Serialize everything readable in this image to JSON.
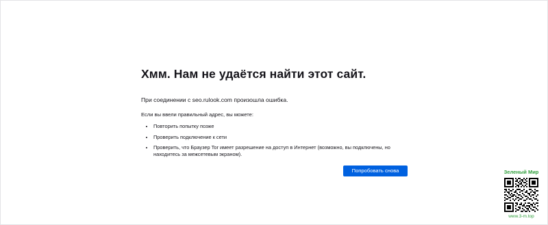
{
  "error": {
    "title": "Хмм. Нам не удаётся найти этот сайт.",
    "description": "При соединении с seo.rulook.com произошла ошибка.",
    "hint": "Если вы ввели правильный адрес, вы можете:",
    "suggestions": [
      "Повторить попытку позже",
      "Проверить подключение к сети",
      "Проверить, что Браузер Tor имеет разрешение на доступ в Интернет (возможно, вы подключены, но находитесь за межсетевым экраном)."
    ],
    "retry_label": "Попробовать снова"
  },
  "watermark": {
    "title": "Зеленый Мир",
    "url": "www.3-m.top"
  },
  "colors": {
    "button": "#0061e0",
    "watermark": "#2e9e3a"
  }
}
